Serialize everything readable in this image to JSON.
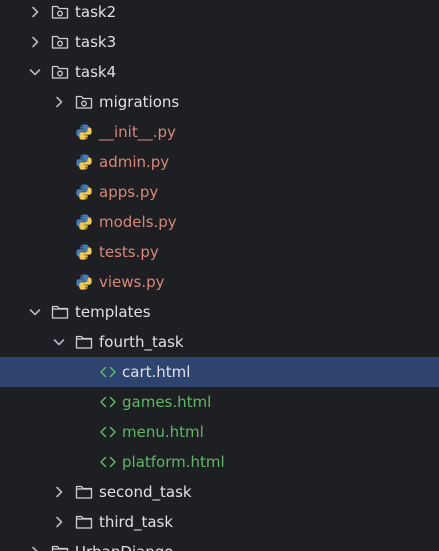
{
  "project_tree": {
    "task2": "task2",
    "task3": "task3",
    "task4": "task4",
    "migrations": "migrations",
    "init_py": "__init__.py",
    "admin_py": "admin.py",
    "apps_py": "apps.py",
    "models_py": "models.py",
    "tests_py": "tests.py",
    "views_py": "views.py",
    "templates": "templates",
    "fourth_task": "fourth_task",
    "cart_html": "cart.html",
    "games_html": "games.html",
    "menu_html": "menu.html",
    "platform_html": "platform.html",
    "second_task": "second_task",
    "third_task": "third_task",
    "urbandjango": "UrbanDjango",
    "selected_item": "cart.html"
  },
  "colors": {
    "background": "#1e1f22",
    "selection": "#2e436e",
    "python_file_text": "#d9877a",
    "html_file_text": "#5fb865",
    "folder_text": "#dfe1e5"
  },
  "icons": {
    "collapsed_chevron": "chevron-right-icon",
    "expanded_chevron": "chevron-down-icon",
    "package": "package-folder-icon",
    "folder": "folder-icon",
    "python_file": "python-file-icon",
    "html_file": "html-file-icon"
  }
}
